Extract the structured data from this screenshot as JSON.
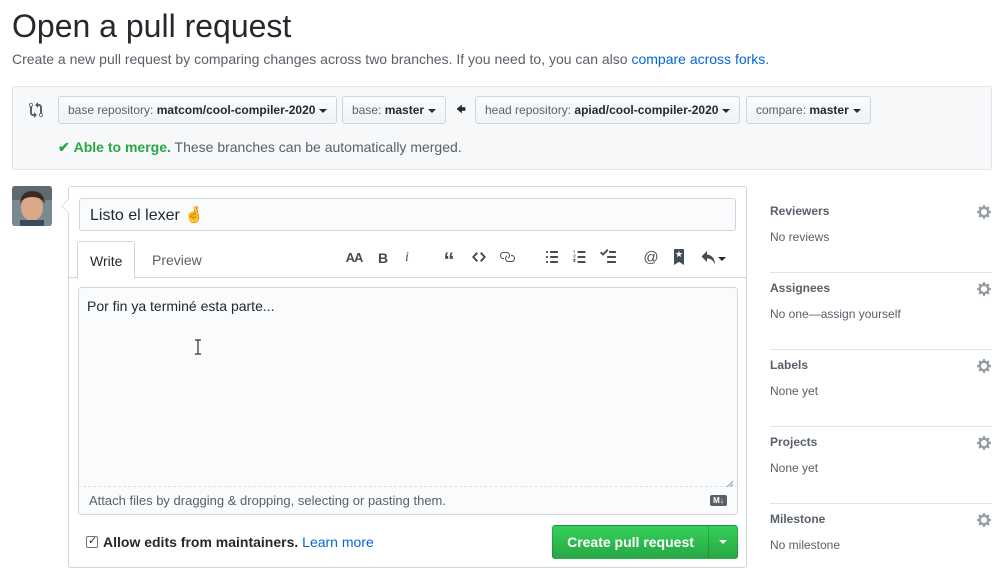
{
  "header": {
    "title": "Open a pull request",
    "subtitle": "Create a new pull request by comparing changes across two branches. If you need to, you can also",
    "subtitle_link": "compare across forks",
    "subtitle_end": "."
  },
  "range": {
    "base_repo_label": "base repository:",
    "base_repo_value": "matcom/cool-compiler-2020",
    "base_label": "base:",
    "base_value": "master",
    "head_repo_label": "head repository:",
    "head_repo_value": "apiad/cool-compiler-2020",
    "compare_label": "compare:",
    "compare_value": "master",
    "merge_ok": "Able to merge.",
    "merge_msg": "These branches can be automatically merged."
  },
  "editor": {
    "title_value": "Listo el lexer 🤞",
    "tab_write": "Write",
    "tab_preview": "Preview",
    "body_text": "Por fin ya terminé esta parte...",
    "attach_text": "Attach files by dragging & dropping, selecting or pasting them.",
    "md_badge": "M↓"
  },
  "footer": {
    "allow_edits_label": "Allow edits from maintainers.",
    "learn_more": "Learn more",
    "create_button": "Create pull request"
  },
  "sidebar": {
    "sections": [
      {
        "title": "Reviewers",
        "value": "No reviews"
      },
      {
        "title": "Assignees",
        "value": "No one—assign yourself"
      },
      {
        "title": "Labels",
        "value": "None yet"
      },
      {
        "title": "Projects",
        "value": "None yet"
      },
      {
        "title": "Milestone",
        "value": "No milestone"
      }
    ]
  },
  "colors": {
    "accent": "#0366d6",
    "success": "#28a745"
  },
  "icons": [
    "compare-icon",
    "arrow-left-icon",
    "check-icon",
    "text-size-icon",
    "bold-icon",
    "italic-icon",
    "quote-icon",
    "code-icon",
    "link-icon",
    "unordered-list-icon",
    "ordered-list-icon",
    "task-list-icon",
    "mention-icon",
    "saved-reply-icon",
    "reply-icon",
    "markdown-icon",
    "gear-icon"
  ]
}
